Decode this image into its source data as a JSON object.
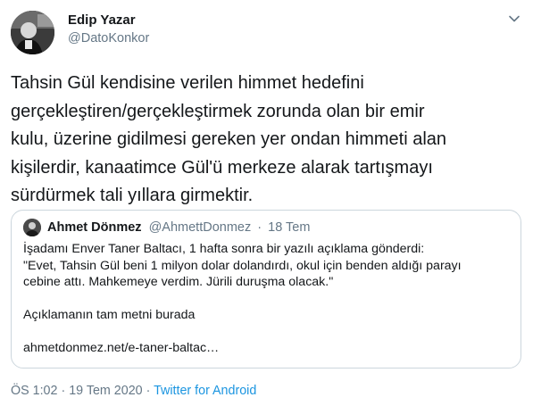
{
  "tweet": {
    "author": {
      "name": "Edip Yazar",
      "handle": "@DatoKonkor",
      "avatar_icon": "profile-photo"
    },
    "text": "Tahsin Gül kendisine verilen himmet hedefini\ngerçekleştiren/gerçekleştirmek zorunda olan bir emir\nkulu, üzerine gidilmesi gereken yer ondan himmeti alan\nkişilerdir, kanaatimce Gül'ü merkeze alarak tartışmayı\nsürdürmek tali yıllara girmektir.",
    "menu_icon": "chevron-down-icon",
    "time": "ÖS 1:02",
    "date": "19 Tem 2020",
    "separator": "·",
    "source": "Twitter for Android"
  },
  "quoted_tweet": {
    "author": {
      "name": "Ahmet Dönmez",
      "handle": "@AhmettDonmez",
      "avatar_icon": "profile-photo"
    },
    "separator": "·",
    "date": "18 Tem",
    "text": "İşadamı Enver Taner Baltacı, 1 hafta sonra bir yazılı açıklama gönderdi:\n\"Evet, Tahsin Gül beni 1 milyon dolar dolandırdı, okul için benden aldığı parayı\ncebine attı. Mahkemeye verdim. Jürili duruşma olacak.\"\n\nAçıklamanın tam metni burada\n\nahmetdonmez.net/e-taner-baltac…"
  },
  "colors": {
    "text_primary": "#14171a",
    "text_secondary": "#657786",
    "link": "#1b95e0",
    "border": "#ccd6dd"
  }
}
